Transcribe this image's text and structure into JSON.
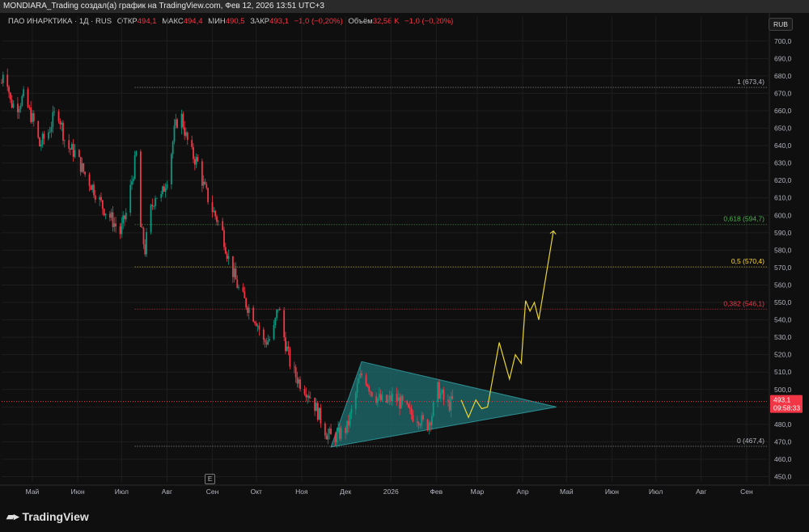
{
  "header": {
    "title": "MONDIARA_Trading создал(а) график на TradingView.com, Фев 12, 2026 13:51 UTC+3"
  },
  "legend": {
    "symbol": "ПАО ИНАРКТИКА · 1Д · RUS",
    "open_label": "ОТКР",
    "open": "494,1",
    "high_label": "МАКС",
    "high": "494,4",
    "low_label": "МИН",
    "low": "490,5",
    "close_label": "ЗАКР",
    "close": "493,1",
    "change": "−1,0 (−0,20%)",
    "volume_label": "Объём",
    "volume": "32,56 K",
    "volume_change": "−1,0 (−0,20%)"
  },
  "currency_button": "RUB",
  "e_marker": "E",
  "brand": "TradingView",
  "colors": {
    "background": "#0f0f0f",
    "up": "#089981",
    "down": "#f23645",
    "triangle_fill": "#1f6f72",
    "fib_1": "#b2b5be",
    "fib_0618": "#4caf50",
    "fib_05": "#fdd835",
    "fib_0382": "#f23645",
    "fib_0": "#b2b5be",
    "projection": "#e8d533",
    "price_tag": "#f23645"
  },
  "chart_data": {
    "type": "candlestick",
    "y_axis": {
      "ylim": [
        447,
        705
      ],
      "ticks": [
        "700,0",
        "690,0",
        "680,0",
        "670,0",
        "660,0",
        "650,0",
        "640,0",
        "630,0",
        "620,0",
        "610,0",
        "600,0",
        "590,0",
        "580,0",
        "570,0",
        "560,0",
        "550,0",
        "540,0",
        "530,0",
        "520,0",
        "510,0",
        "500,0",
        "490,0",
        "480,0",
        "470,0",
        "460,0",
        "450,0"
      ],
      "tick_values": [
        700,
        690,
        680,
        670,
        660,
        650,
        640,
        630,
        620,
        610,
        600,
        590,
        580,
        570,
        560,
        550,
        540,
        530,
        520,
        510,
        500,
        490,
        480,
        470,
        460,
        450
      ]
    },
    "x_axis": {
      "labels": [
        "Май",
        "Июн",
        "Июл",
        "Авг",
        "Сен",
        "Окт",
        "Ноя",
        "Дек",
        "2026",
        "Фев",
        "Мар",
        "Апр",
        "Май",
        "Июн",
        "Июл",
        "Авг",
        "Сен"
      ],
      "label_dates": [
        "2025-05-01",
        "2025-06-01",
        "2025-07-01",
        "2025-08-01",
        "2025-09-01",
        "2025-10-01",
        "2025-11-01",
        "2025-12-01",
        "2026-01-01",
        "2026-02-01",
        "2026-03-01",
        "2026-04-01",
        "2026-05-01",
        "2026-06-01",
        "2026-07-01",
        "2026-08-01",
        "2026-09-01"
      ],
      "range": [
        "2025-04-10",
        "2026-09-16"
      ]
    },
    "price_path": [
      [
        "2025-04-10",
        676
      ],
      [
        "2025-04-12",
        690
      ],
      [
        "2025-04-16",
        665
      ],
      [
        "2025-04-20",
        662
      ],
      [
        "2025-04-25",
        668
      ],
      [
        "2025-05-02",
        653
      ],
      [
        "2025-05-06",
        640
      ],
      [
        "2025-05-12",
        648
      ],
      [
        "2025-05-18",
        662
      ],
      [
        "2025-05-24",
        640
      ],
      [
        "2025-05-30",
        636
      ],
      [
        "2025-06-05",
        625
      ],
      [
        "2025-06-12",
        615
      ],
      [
        "2025-06-18",
        605
      ],
      [
        "2025-06-24",
        598
      ],
      [
        "2025-06-30",
        590
      ],
      [
        "2025-07-04",
        601
      ],
      [
        "2025-07-08",
        620
      ],
      [
        "2025-07-12",
        640
      ],
      [
        "2025-07-14",
        593
      ],
      [
        "2025-07-17",
        580
      ],
      [
        "2025-07-20",
        600
      ],
      [
        "2025-07-24",
        612
      ],
      [
        "2025-07-28",
        610
      ],
      [
        "2025-08-02",
        625
      ],
      [
        "2025-08-06",
        648
      ],
      [
        "2025-08-10",
        660
      ],
      [
        "2025-08-14",
        645
      ],
      [
        "2025-08-18",
        635
      ],
      [
        "2025-08-22",
        630
      ],
      [
        "2025-08-26",
        617
      ],
      [
        "2025-08-31",
        605
      ],
      [
        "2025-09-04",
        598
      ],
      [
        "2025-09-08",
        590
      ],
      [
        "2025-09-12",
        575
      ],
      [
        "2025-09-16",
        565
      ],
      [
        "2025-09-20",
        555
      ],
      [
        "2025-09-25",
        548
      ],
      [
        "2025-10-01",
        540
      ],
      [
        "2025-10-06",
        527
      ],
      [
        "2025-10-12",
        530
      ],
      [
        "2025-10-16",
        548
      ],
      [
        "2025-10-20",
        530
      ],
      [
        "2025-10-25",
        512
      ],
      [
        "2025-10-30",
        505
      ],
      [
        "2025-11-04",
        500
      ],
      [
        "2025-11-08",
        495
      ],
      [
        "2025-11-13",
        485
      ],
      [
        "2025-11-18",
        475
      ],
      [
        "2025-11-22",
        472
      ],
      [
        "2025-11-26",
        474
      ],
      [
        "2025-12-02",
        478
      ],
      [
        "2025-12-06",
        490
      ],
      [
        "2025-12-10",
        505
      ],
      [
        "2025-12-13",
        510
      ],
      [
        "2025-12-18",
        500
      ],
      [
        "2025-12-23",
        495
      ],
      [
        "2025-12-28",
        492
      ],
      [
        "2026-01-03",
        496
      ],
      [
        "2026-01-08",
        492
      ],
      [
        "2026-01-14",
        486
      ],
      [
        "2026-01-20",
        484
      ],
      [
        "2026-01-25",
        478
      ],
      [
        "2026-01-29",
        486
      ],
      [
        "2026-02-02",
        500
      ],
      [
        "2026-02-05",
        496
      ],
      [
        "2026-02-08",
        490
      ],
      [
        "2026-02-12",
        493.1
      ]
    ],
    "triangle": {
      "vertices": [
        [
          "2025-11-21",
          467
        ],
        [
          "2025-12-12",
          516
        ],
        [
          "2026-04-24",
          490
        ]
      ]
    },
    "fibonacci": [
      {
        "label": "1 (673,4)",
        "value": 673.4,
        "color": "#b2b5be"
      },
      {
        "label": "0,618 (594,7)",
        "value": 594.7,
        "color": "#4caf50"
      },
      {
        "label": "0,5 (570,4)",
        "value": 570.4,
        "color": "#fdd835"
      },
      {
        "label": "0,382 (546,1)",
        "value": 546.1,
        "color": "#f23645"
      },
      {
        "label": "0 (467,4)",
        "value": 467.4,
        "color": "#b2b5be"
      }
    ],
    "fib_start_date": "2025-07-10",
    "projection_path": [
      [
        "2026-02-18",
        494
      ],
      [
        "2026-02-23",
        484
      ],
      [
        "2026-02-28",
        494
      ],
      [
        "2026-03-04",
        489
      ],
      [
        "2026-03-08",
        490
      ],
      [
        "2026-03-16",
        527
      ],
      [
        "2026-03-23",
        506
      ],
      [
        "2026-03-27",
        520
      ],
      [
        "2026-03-31",
        515
      ],
      [
        "2026-04-03",
        551
      ],
      [
        "2026-04-06",
        545
      ],
      [
        "2026-04-09",
        550
      ],
      [
        "2026-04-12",
        540
      ],
      [
        "2026-04-22",
        591
      ]
    ],
    "current_price": {
      "value": 493.1,
      "label": "493,1",
      "countdown": "09:58:33"
    }
  }
}
